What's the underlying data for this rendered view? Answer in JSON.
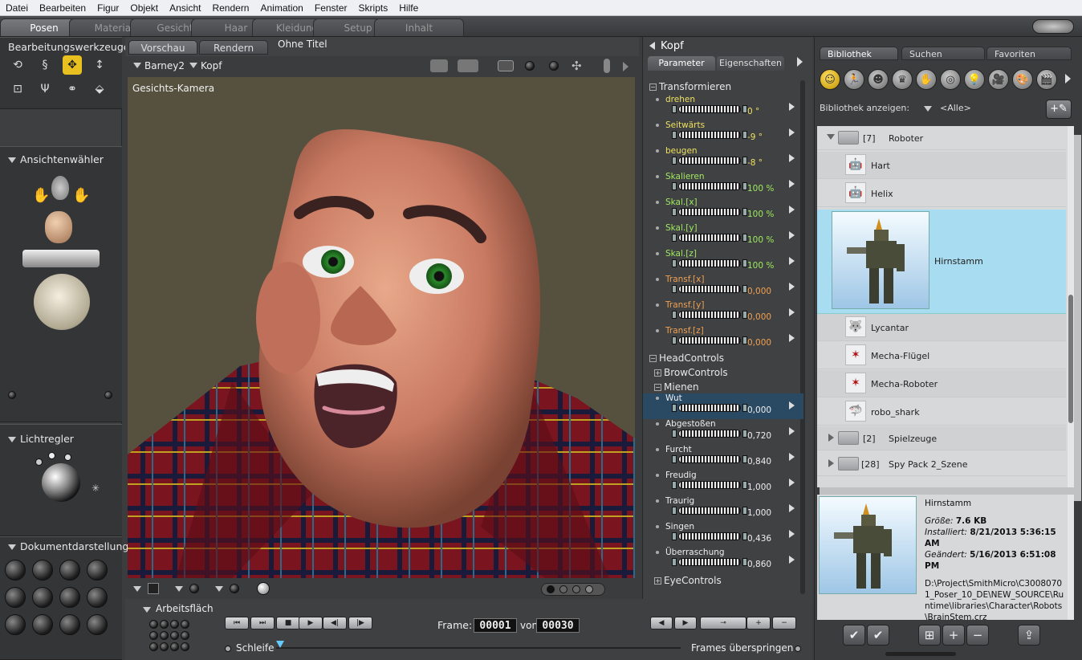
{
  "menu": [
    "Datei",
    "Bearbeiten",
    "Figur",
    "Objekt",
    "Ansicht",
    "Rendern",
    "Animation",
    "Fenster",
    "Skripts",
    "Hilfe"
  ],
  "rooms": [
    {
      "label": "Posen",
      "active": true
    },
    {
      "label": "Material",
      "active": false
    },
    {
      "label": "Gesicht",
      "active": false
    },
    {
      "label": "Haar",
      "active": false
    },
    {
      "label": "Kleidung",
      "active": false
    },
    {
      "label": "Setup",
      "active": false
    },
    {
      "label": "Inhalt",
      "active": false
    }
  ],
  "left": {
    "tools_title": "Bearbeitungswerkzeuge",
    "view_selector": "Ansichtenwähler",
    "lights": "Lichtregler",
    "document_display": "Dokumentdarstellung",
    "workspace": "Arbeitsfläch"
  },
  "viewport": {
    "tabs": [
      "Vorschau",
      "Rendern"
    ],
    "document_title": "Ohne Titel",
    "figure": "Barney2",
    "actor": "Kopf",
    "camera_label": "Gesichts-Kamera"
  },
  "params": {
    "title": "Kopf",
    "tabs": [
      "Parameter",
      "Eigenschaften"
    ],
    "group_transform": "Transformieren",
    "transform": [
      {
        "label": "drehen",
        "value": "0 °",
        "color": "#f0e060"
      },
      {
        "label": "Seitwärts",
        "value": "-9 °",
        "color": "#f0e060"
      },
      {
        "label": "beugen",
        "value": "-8 °",
        "color": "#f0e060"
      },
      {
        "label": "Skalieren",
        "value": "100 %",
        "color": "#a0e860"
      },
      {
        "label": "Skal.[x]",
        "value": "100 %",
        "color": "#a0e860"
      },
      {
        "label": "Skal.[y]",
        "value": "100 %",
        "color": "#a0e860"
      },
      {
        "label": "Skal.[z]",
        "value": "100 %",
        "color": "#a0e860"
      },
      {
        "label": "Transf.[x]",
        "value": "0,000",
        "color": "#f0a050"
      },
      {
        "label": "Transf.[y]",
        "value": "0,000",
        "color": "#f0a050"
      },
      {
        "label": "Transf.[z]",
        "value": "0,000",
        "color": "#f0a050"
      }
    ],
    "group_head": "HeadControls",
    "group_brow": "BrowControls",
    "group_mienen": "Mienen",
    "mienen": [
      {
        "label": "Wut",
        "value": "0,000"
      },
      {
        "label": "Abgestoßen",
        "value": "0,720"
      },
      {
        "label": "Furcht",
        "value": "0,840"
      },
      {
        "label": "Freudig",
        "value": "1,000"
      },
      {
        "label": "Traurig",
        "value": "1,000"
      },
      {
        "label": "Singen",
        "value": "0,436"
      },
      {
        "label": "Überraschung",
        "value": "0,860"
      }
    ],
    "group_eye": "EyeControls"
  },
  "library": {
    "tabs": [
      "Bibliothek",
      "Suchen",
      "Favoriten"
    ],
    "show_label": "Bibliothek anzeigen:",
    "show_value": "<Alle>",
    "categories": [
      "figure-icon",
      "pose-icon",
      "face-icon",
      "hair-icon",
      "hand-icon",
      "prop-icon",
      "light-icon",
      "camera-icon",
      "material-icon",
      "scene-icon"
    ],
    "folder_robots": {
      "count": "[7]",
      "name": "Roboter"
    },
    "items": [
      {
        "name": "Hart",
        "icon": "🤖"
      },
      {
        "name": "Helix",
        "icon": "🤖"
      },
      {
        "name": "Hirnstamm",
        "icon": "🤖"
      },
      {
        "name": "Lycantar",
        "icon": "🐺"
      },
      {
        "name": "Mecha-Flügel",
        "icon": "✶"
      },
      {
        "name": "Mecha-Roboter",
        "icon": "✶"
      },
      {
        "name": "robo_shark",
        "icon": "🦈"
      }
    ],
    "folders": [
      {
        "count": "[2]",
        "name": "Spielzeuge"
      },
      {
        "count": "[28]",
        "name": "Spy Pack 2_Szene"
      }
    ],
    "info": {
      "name": "Hirnstamm",
      "size_label": "Größe:",
      "size": "7.6 KB",
      "installed_label": "Installiert:",
      "installed": "8/21/2013 5:36:15 AM",
      "changed_label": "Geändert:",
      "changed": "5/16/2013 6:51:08 PM",
      "path": "D:\\Project\\SmithMicro\\C30080701_Poser_10_DE\\NEW_SOURCE\\Runtime\\libraries\\Character\\Robots\\BrainStem.crz"
    }
  },
  "timeline": {
    "frame_label": "Frame:",
    "frame": "00001",
    "of_label": "von",
    "total": "00030",
    "loop_label": "Schleife",
    "skip_label": "Frames überspringen"
  }
}
